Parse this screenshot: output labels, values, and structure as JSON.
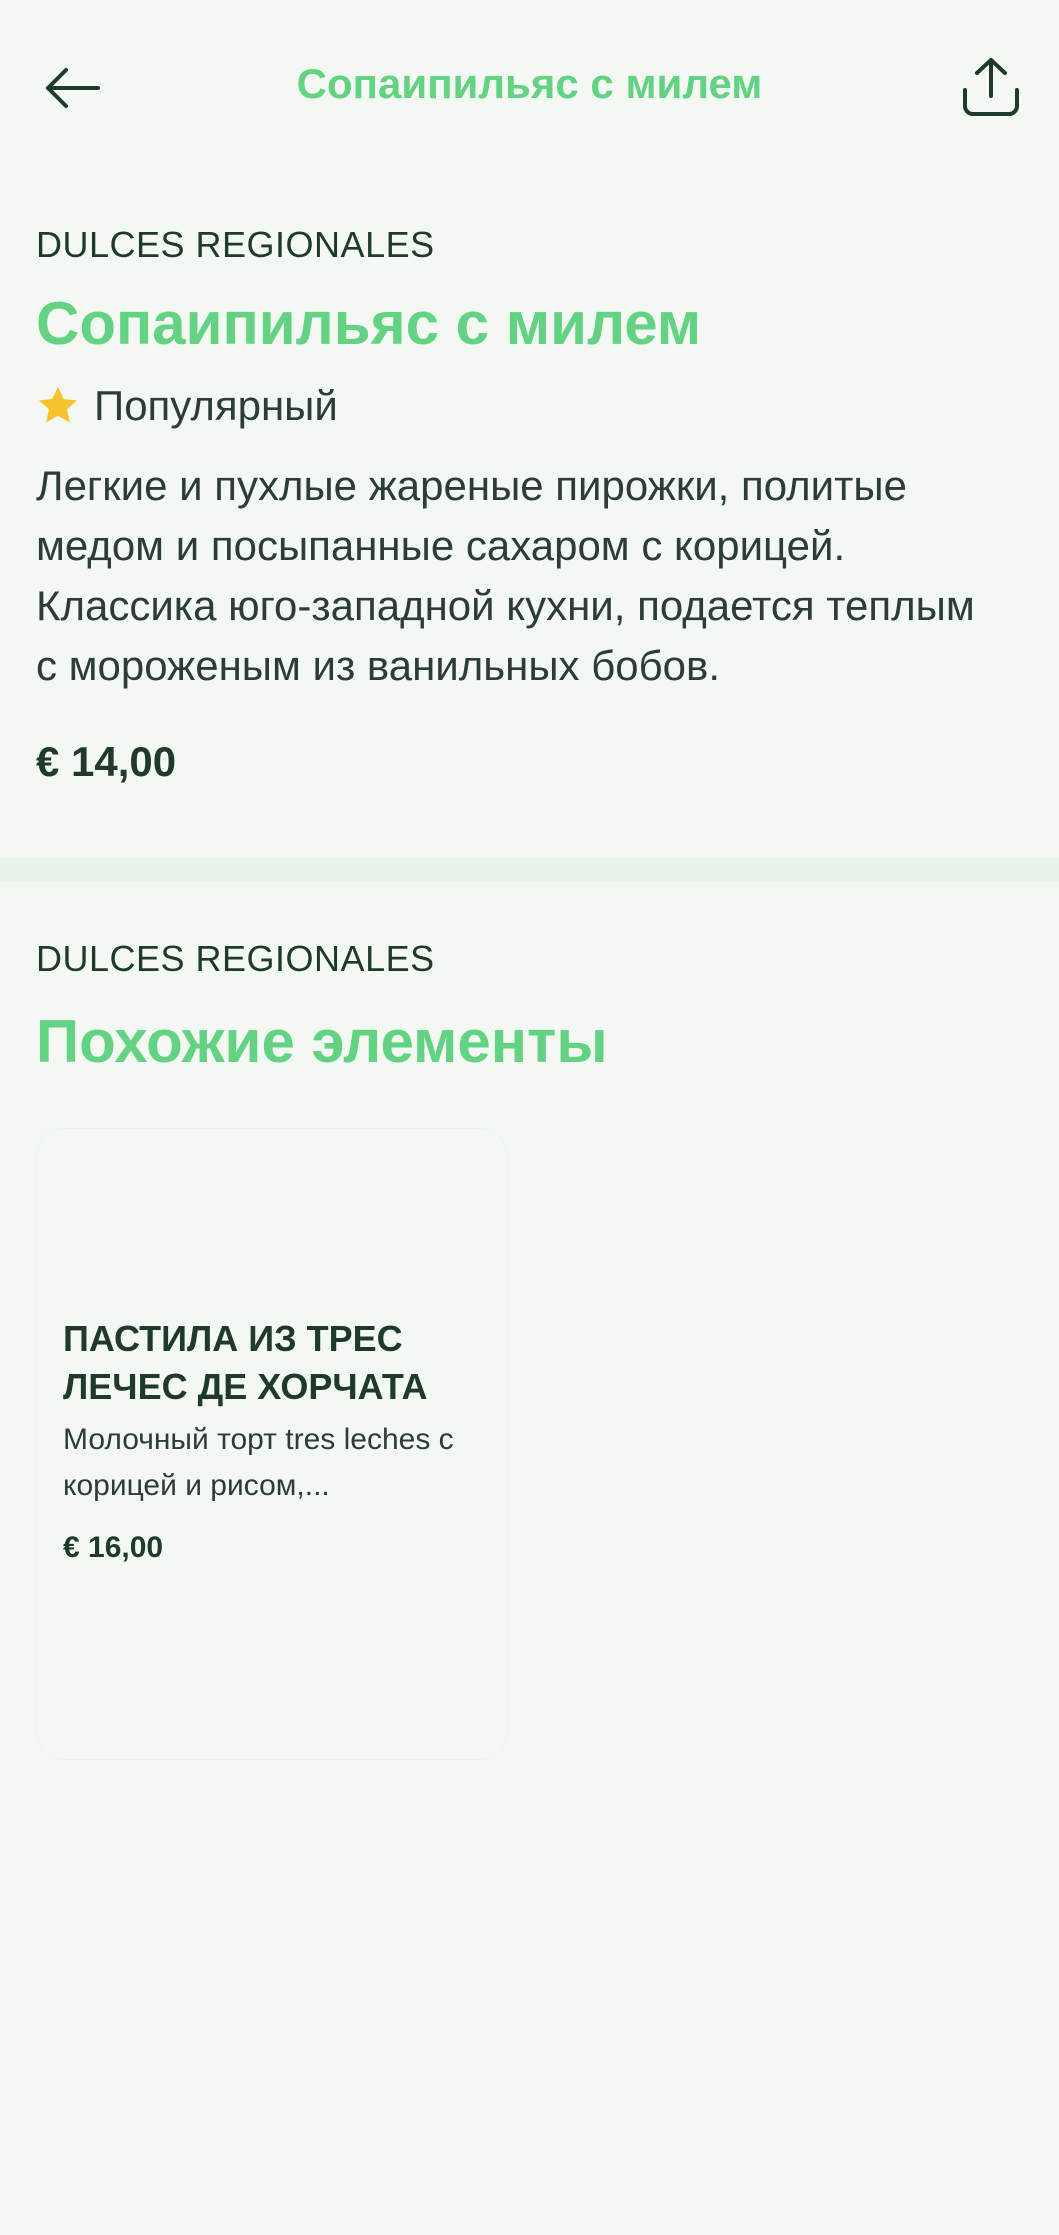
{
  "header": {
    "title": "Сопаипильяс с милем",
    "back_icon": "arrow-left-icon",
    "share_icon": "share-icon"
  },
  "item": {
    "category": "DULCES REGIONALES",
    "title": "Сопаипильяс с милем",
    "badge": "Популярный",
    "badge_icon": "star-icon",
    "description": "Легкие и пухлые жареные пирожки, политые медом и посыпанные сахаром с корицей. Классика юго-западной кухни, подается теплым с мороженым из ванильных бобов.",
    "price": "€ 14,00"
  },
  "similar": {
    "category": "DULCES REGIONALES",
    "title": "Похожие элементы",
    "items": [
      {
        "name": "ПАСТИЛА ИЗ ТРЕС ЛЕЧЕС ДЕ ХОРЧАТА",
        "description": "Молочный торт tres leches с корицей и рисом,...",
        "price": "€ 16,00"
      }
    ]
  },
  "colors": {
    "accent": "#63d283",
    "background": "#f3f8f3",
    "text": "#1f3a2a",
    "star": "#f5c32c"
  }
}
